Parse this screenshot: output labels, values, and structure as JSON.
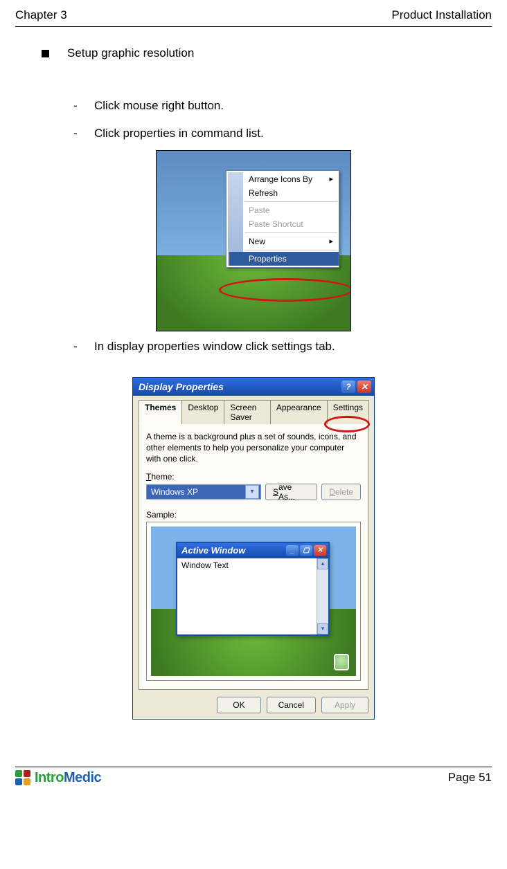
{
  "header": {
    "left": "Chapter 3",
    "right": "Product Installation"
  },
  "bullet": "Setup graphic resolution",
  "items": [
    "Click mouse right button.",
    "Click properties in command list.",
    "In display properties window click settings tab."
  ],
  "context_menu": {
    "arrange": "Arrange Icons By",
    "refresh": "Refresh",
    "paste": "Paste",
    "paste_shortcut": "Paste Shortcut",
    "new": "New",
    "properties": "Properties"
  },
  "dialog": {
    "title": "Display Properties",
    "tabs": {
      "themes": "Themes",
      "desktop": "Desktop",
      "screensaver": "Screen Saver",
      "appearance": "Appearance",
      "settings": "Settings"
    },
    "theme_desc": "A theme is a background plus a set of sounds, icons, and other elements to help you personalize your computer with one click.",
    "theme_label": "Theme:",
    "theme_value": "Windows XP",
    "save_as": "Save As...",
    "delete": "Delete",
    "sample_label": "Sample:",
    "active_window_title": "Active Window",
    "window_text": "Window Text",
    "ok": "OK",
    "cancel": "Cancel",
    "apply": "Apply"
  },
  "footer": {
    "page": "Page 51",
    "logo_intro": "Intro",
    "logo_medic": "Medic"
  }
}
